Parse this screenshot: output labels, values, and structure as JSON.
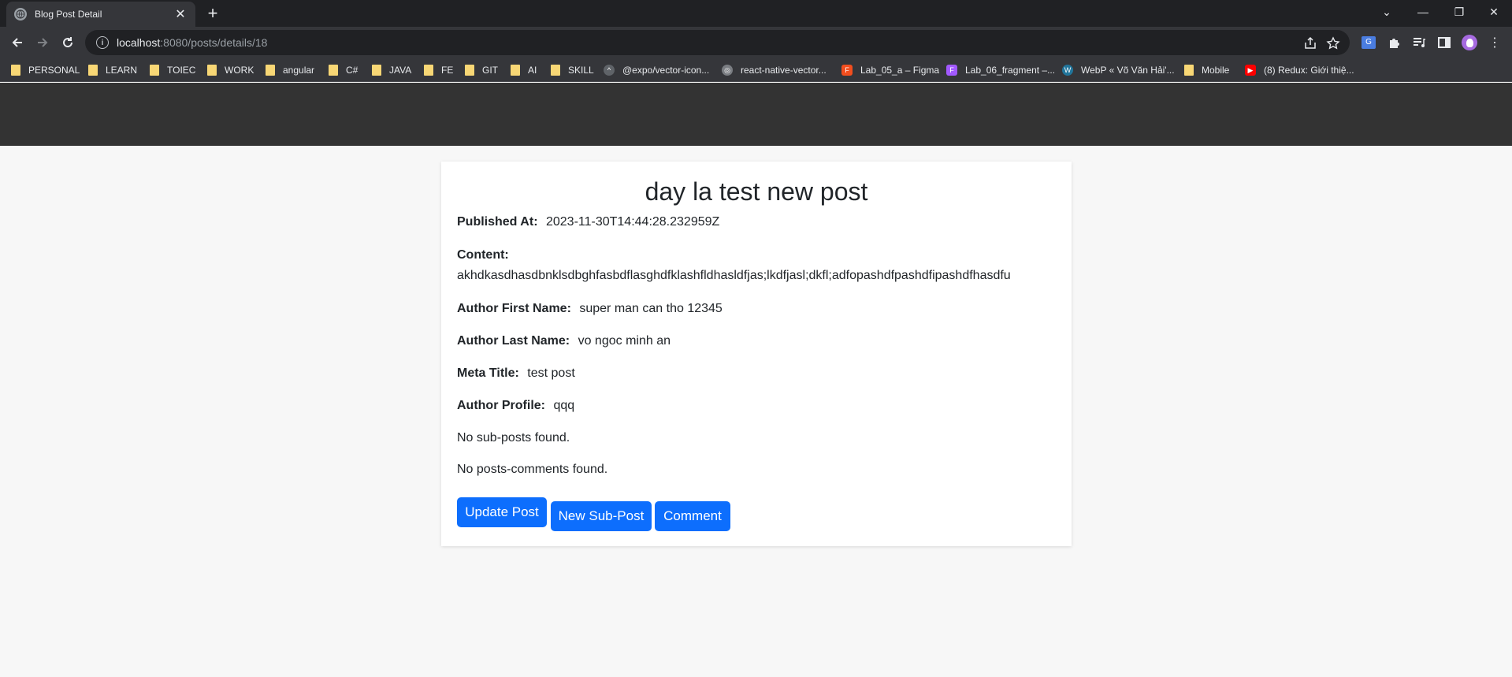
{
  "browser": {
    "tab_title": "Blog Post Detail",
    "url_host": "localhost",
    "url_path": ":8080/posts/details/18",
    "bookmarks": [
      {
        "label": "PERSONAL",
        "type": "folder"
      },
      {
        "label": "LEARN",
        "type": "folder"
      },
      {
        "label": "TOIEC",
        "type": "folder"
      },
      {
        "label": "WORK",
        "type": "folder"
      },
      {
        "label": "angular",
        "type": "folder"
      },
      {
        "label": "C#",
        "type": "folder"
      },
      {
        "label": "JAVA",
        "type": "folder"
      },
      {
        "label": "FE",
        "type": "folder"
      },
      {
        "label": "GIT",
        "type": "folder"
      },
      {
        "label": "AI",
        "type": "folder"
      },
      {
        "label": "SKILL",
        "type": "folder"
      },
      {
        "label": "@expo/vector-icon...",
        "type": "expo"
      },
      {
        "label": "react-native-vector...",
        "type": "globe"
      },
      {
        "label": "Lab_05_a – Figma",
        "type": "figma"
      },
      {
        "label": "Lab_06_fragment –...",
        "type": "figma"
      },
      {
        "label": "WebP « Võ Văn Hải'...",
        "type": "wordpress"
      },
      {
        "label": "Mobile",
        "type": "folder"
      },
      {
        "label": "(8) Redux: Giới thiệ...",
        "type": "youtube"
      }
    ]
  },
  "post": {
    "title": "day la test new post",
    "published_label": "Published At:",
    "published_value": "2023-11-30T14:44:28.232959Z",
    "content_label": "Content:",
    "content_value": "akhdkasdhasdbnklsdbghfasbdflasghdfklashfldhasldfjas;lkdfjasl;dkfl;adfopashdfpashdfipashdfhasdfu",
    "first_name_label": "Author First Name:",
    "first_name_value": "super man can tho 12345",
    "last_name_label": "Author Last Name:",
    "last_name_value": "vo ngoc minh an",
    "meta_title_label": "Meta Title:",
    "meta_title_value": "test post",
    "profile_label": "Author Profile:",
    "profile_value": "qqq",
    "no_subposts": "No sub-posts found.",
    "no_comments": "No posts-comments found."
  },
  "actions": {
    "update": "Update Post",
    "new_subpost": "New Sub-Post",
    "comment": "Comment"
  },
  "colors": {
    "primary_button": "#0d6efd",
    "header_bar": "#333333"
  }
}
